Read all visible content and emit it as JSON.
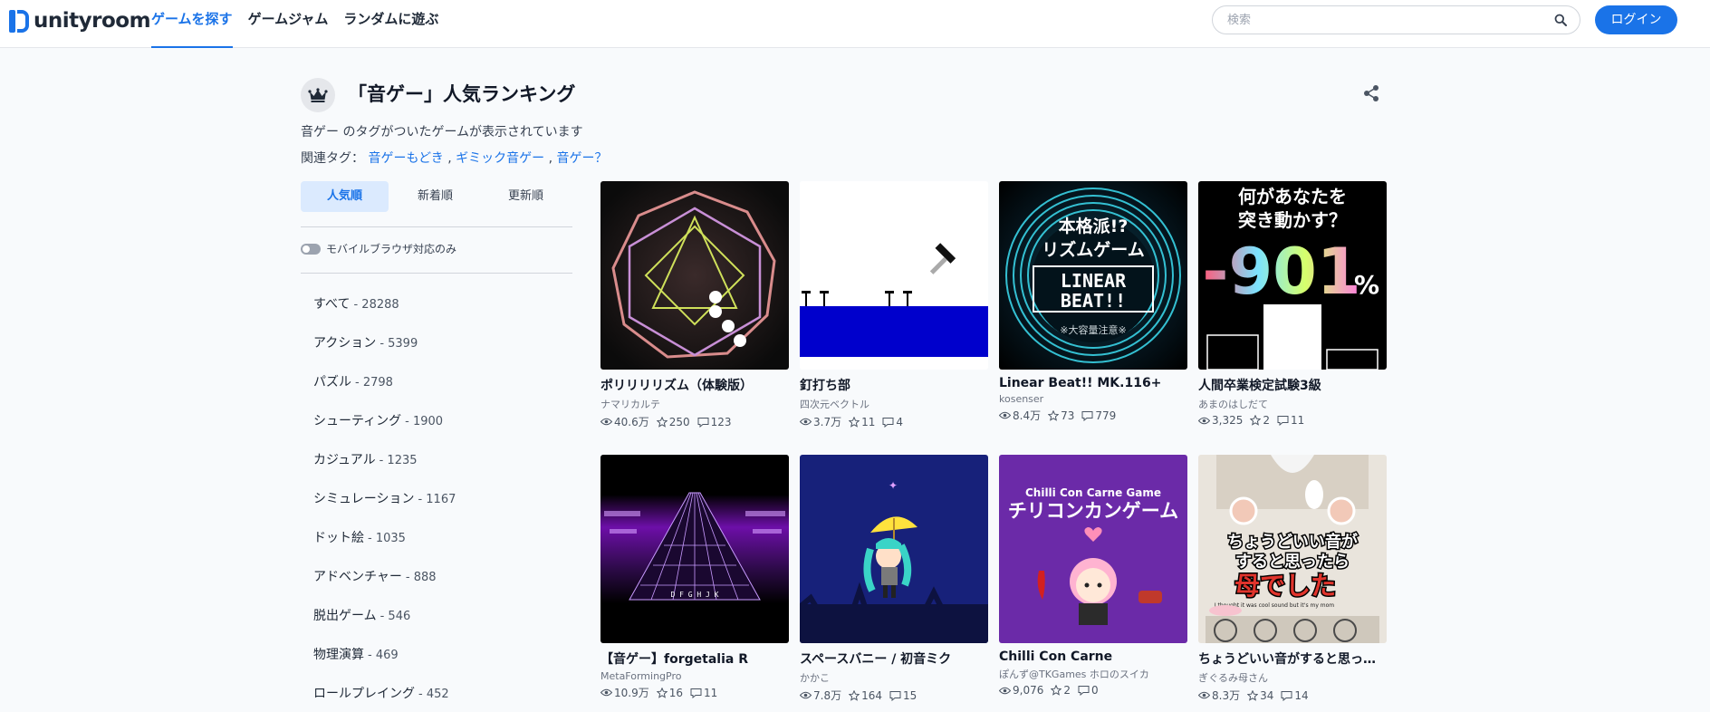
{
  "header": {
    "logo_text": "unityroom",
    "nav": [
      "ゲームを探す",
      "ゲームジャム",
      "ランダムに遊ぶ"
    ],
    "search_placeholder": "検索",
    "login_label": "ログイン"
  },
  "page": {
    "title": "「音ゲー」人気ランキング",
    "description": "音ゲー のタグがついたゲームが表示されています",
    "related_label": "関連タグ：",
    "related_tags": [
      "音ゲーもどき",
      "ギミック音ゲー",
      "音ゲー？"
    ],
    "related_sep": ","
  },
  "sort_tabs": [
    "人気順",
    "新着順",
    "更新順"
  ],
  "mobile_toggle_label": "モバイルブラウザ対応のみ",
  "categories": [
    {
      "name": "すべて",
      "count": "- 28288"
    },
    {
      "name": "アクション",
      "count": "- 5399"
    },
    {
      "name": "パズル",
      "count": "- 2798"
    },
    {
      "name": "シューティング",
      "count": "- 1900"
    },
    {
      "name": "カジュアル",
      "count": "- 1235"
    },
    {
      "name": "シミュレーション",
      "count": "- 1167"
    },
    {
      "name": "ドット絵",
      "count": "- 1035"
    },
    {
      "name": "アドベンチャー",
      "count": "- 888"
    },
    {
      "name": "脱出ゲーム",
      "count": "- 546"
    },
    {
      "name": "物理演算",
      "count": "- 469"
    },
    {
      "name": "ロールプレイング",
      "count": "- 452"
    }
  ],
  "games": [
    {
      "title": "ポリリリリズム（体験版）",
      "author": "ナマリカルテ",
      "views": "40.6万",
      "stars": "250",
      "comments": "123"
    },
    {
      "title": "釘打ち部",
      "author": "四次元ベクトル",
      "views": "3.7万",
      "stars": "11",
      "comments": "4"
    },
    {
      "title": "Linear Beat!! MK.116+",
      "author": "kosenser",
      "views": "8.4万",
      "stars": "73",
      "comments": "779"
    },
    {
      "title": "人間卒業検定試験3級",
      "author": "あまのはしだて",
      "views": "3,325",
      "stars": "2",
      "comments": "11"
    },
    {
      "title": "【音ゲー】forgetalia R",
      "author": "MetaFormingPro",
      "views": "10.9万",
      "stars": "16",
      "comments": "11"
    },
    {
      "title": "スペースバニー / 初音ミク",
      "author": "かかこ",
      "views": "7.8万",
      "stars": "164",
      "comments": "15"
    },
    {
      "title": "Chilli Con Carne",
      "author": "ぽんず@TKGames ホロのスイカ",
      "views": "9,076",
      "stars": "2",
      "comments": "0"
    },
    {
      "title": "ちょうどいい音がすると思ったら母でした",
      "author": "ぎぐるみ母さん",
      "views": "8.3万",
      "stars": "34",
      "comments": "14"
    }
  ],
  "thumb_text": {
    "linear_top": "本格派!?",
    "linear_mid": "リズムゲーム",
    "linear_logo1": "LINEAR",
    "linear_logo2": "BEAT!!",
    "linear_warn": "※大容量注意※",
    "ningen_1": "何があなたを",
    "ningen_2": "突き動かす？",
    "ningen_num": "-901",
    "ningen_pct": "%",
    "forget_keys": "D F G H J K",
    "chilli_en": "Chilli Con Carne Game",
    "chilli_jp": "チリコンカンゲーム",
    "haha_1": "ちょうどいい音が",
    "haha_2": "すると思ったら",
    "haha_3": "母でした",
    "haha_en": "I thought it was cool sound but it's my mom"
  },
  "colors": {
    "accent": "#1a73e8",
    "tab_active_bg": "#dbeafe"
  }
}
